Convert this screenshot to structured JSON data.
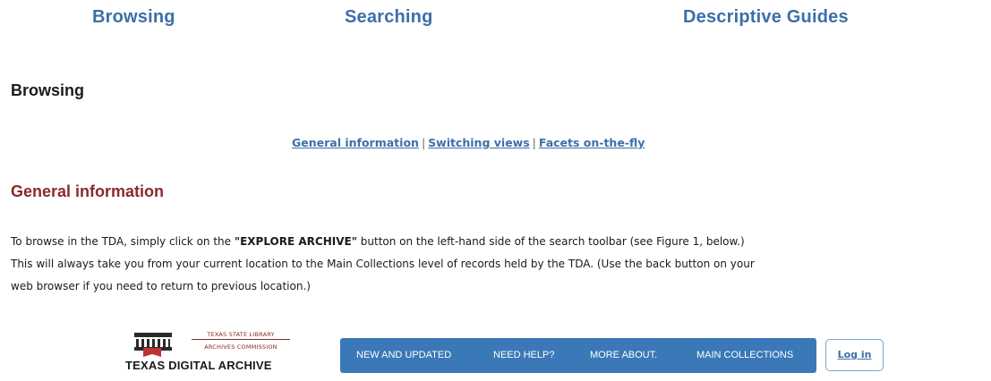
{
  "top_nav": {
    "browsing": "Browsing",
    "searching": "Searching",
    "descriptive_guides": "Descriptive Guides"
  },
  "section": {
    "heading": "Browsing",
    "sub_links": [
      "General information",
      "Switching views",
      "Facets on-the-fly"
    ],
    "separator": "|"
  },
  "general_info": {
    "heading": "General information",
    "text_before": "To browse in the TDA, simply click on the ",
    "button_name": "\"EXPLORE ARCHIVE\"",
    "text_after": " button on the left-hand side of the search toolbar (see Figure 1, below.)\nThis will always take you from your current location to the Main Collections level of records held by the TDA. (Use the back button on your\nweb browser if you need to return to previous location.)"
  },
  "figure": {
    "logo": {
      "line1": "TEXAS STATE LIBRARY",
      "line2": "ARCHIVES COMMISSION",
      "name": "TEXAS DIGITAL ARCHIVE"
    },
    "toolbar": [
      "NEW AND UPDATED",
      "NEED HELP?",
      "MORE ABOUT.",
      "MAIN COLLECTIONS"
    ],
    "login_label": "Log in",
    "colors": {
      "toolbar": "#3a78b7",
      "link": "#3d6fa8",
      "heading_accent": "#8a2a2a"
    }
  }
}
